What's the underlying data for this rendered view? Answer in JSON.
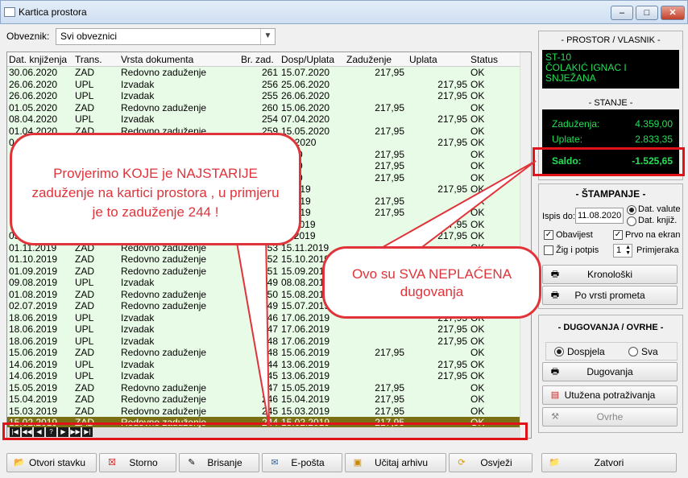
{
  "window": {
    "title": "Kartica prostora",
    "min": "–",
    "max": "□",
    "close": "✕"
  },
  "filter": {
    "label": "Obveznik:",
    "value": "Svi obveznici"
  },
  "table": {
    "columns": [
      "Dat. knjiženja",
      "Trans.",
      "Vrsta dokumenta",
      "Br. zad.",
      "Dosp/Uplata",
      "Zaduženje",
      "Uplata",
      "Status"
    ],
    "rows": [
      [
        "30.06.2020",
        "ZAD",
        "Redovno zaduženje",
        "261",
        "15.07.2020",
        "217,95",
        "",
        "OK"
      ],
      [
        "26.06.2020",
        "UPL",
        "Izvadak",
        "256",
        "25.06.2020",
        "",
        "217,95",
        "OK"
      ],
      [
        "26.06.2020",
        "UPL",
        "Izvadak",
        "255",
        "26.06.2020",
        "",
        "217,95",
        "OK"
      ],
      [
        "01.05.2020",
        "ZAD",
        "Redovno zaduženje",
        "260",
        "15.06.2020",
        "217,95",
        "",
        "OK"
      ],
      [
        "08.04.2020",
        "UPL",
        "Izvadak",
        "254",
        "07.04.2020",
        "",
        "217,95",
        "OK"
      ],
      [
        "01.04.2020",
        "ZAD",
        "Redovno zaduženje",
        "259",
        "15.05.2020",
        "217,95",
        "",
        "OK"
      ],
      [
        "04",
        "",
        "",
        "",
        "03.2020",
        "",
        "217,95",
        "OK"
      ],
      [
        "",
        "",
        "",
        "",
        "2020",
        "217,95",
        "",
        "OK"
      ],
      [
        "",
        "",
        "",
        "",
        "2020",
        "217,95",
        "",
        "OK"
      ],
      [
        "",
        "",
        "",
        "",
        "2020",
        "217,95",
        "",
        "OK"
      ],
      [
        "",
        "",
        "",
        "",
        "2.2019",
        "",
        "217,95",
        "OK"
      ],
      [
        "",
        "",
        "",
        "",
        "2.2019",
        "217,95",
        "",
        "OK"
      ],
      [
        "",
        "",
        "",
        "",
        "1.2019",
        "217,95",
        "",
        "OK"
      ],
      [
        "",
        "",
        "",
        "",
        "11.2019",
        "",
        "217,95",
        "OK"
      ],
      [
        "05",
        "",
        "",
        "",
        "11.2019",
        "",
        "217,95",
        "OK"
      ],
      [
        "01.11.2019",
        "ZAD",
        "Redovno zaduženje",
        "253",
        "15.11.2019",
        "",
        "",
        "OK"
      ],
      [
        "01.10.2019",
        "ZAD",
        "Redovno zaduženje",
        "252",
        "15.10.2019",
        "",
        "",
        "OK"
      ],
      [
        "01.09.2019",
        "ZAD",
        "Redovno zaduženje",
        "251",
        "15.09.2019",
        "",
        "",
        "OK"
      ],
      [
        "09.08.2019",
        "UPL",
        "Izvadak",
        "249",
        "08.08.2019",
        "",
        "",
        "OK"
      ],
      [
        "01.08.2019",
        "ZAD",
        "Redovno zaduženje",
        "250",
        "15.08.2019",
        "",
        "",
        "OK"
      ],
      [
        "02.07.2019",
        "ZAD",
        "Redovno zaduženje",
        "249",
        "15.07.2019",
        "",
        "",
        "OK"
      ],
      [
        "18.06.2019",
        "UPL",
        "Izvadak",
        "246",
        "17.06.2019",
        "",
        "217,95",
        "OK"
      ],
      [
        "18.06.2019",
        "UPL",
        "Izvadak",
        "247",
        "17.06.2019",
        "",
        "217,95",
        "OK"
      ],
      [
        "18.06.2019",
        "UPL",
        "Izvadak",
        "248",
        "17.06.2019",
        "",
        "217,95",
        "OK"
      ],
      [
        "15.06.2019",
        "ZAD",
        "Redovno zaduženje",
        "248",
        "15.06.2019",
        "217,95",
        "",
        "OK"
      ],
      [
        "14.06.2019",
        "UPL",
        "Izvadak",
        "244",
        "13.06.2019",
        "",
        "217,95",
        "OK"
      ],
      [
        "14.06.2019",
        "UPL",
        "Izvadak",
        "245",
        "13.06.2019",
        "",
        "217,95",
        "OK"
      ],
      [
        "15.05.2019",
        "ZAD",
        "Redovno zaduženje",
        "247",
        "15.05.2019",
        "217,95",
        "",
        "OK"
      ],
      [
        "15.04.2019",
        "ZAD",
        "Redovno zaduženje",
        "246",
        "15.04.2019",
        "217,95",
        "",
        "OK"
      ],
      [
        "15.03.2019",
        "ZAD",
        "Redovno zaduženje",
        "245",
        "15.03.2019",
        "217,95",
        "",
        "OK"
      ],
      [
        "15.02.2019",
        "ZAD",
        "Redovno zaduženje",
        "244",
        "15.02.2019",
        "217,95",
        "",
        "OK"
      ]
    ],
    "nav": [
      "|◀",
      "◀◀",
      "◀",
      "?",
      "▶",
      "▶▶",
      "▶|"
    ]
  },
  "callouts": {
    "left": "Provjerimo KOJE je NAJSTARIJE zaduženje na kartici prostora , u primjeru je to zaduženje 244 !",
    "right": "Ovo su SVA NEPLAĆENA dugovanja"
  },
  "prostor": {
    "title": "- PROSTOR / VLASNIK -",
    "line1": "ST-10",
    "line2": "ČOLAKIĆ IGNAC I",
    "line3": "SNJEŽANA"
  },
  "stanje": {
    "title": "- STANJE -",
    "zad_label": "Zaduženja:",
    "zad_value": "4.359,00",
    "upl_label": "Uplate:",
    "upl_value": "2.833,35",
    "saldo_label": "Saldo:",
    "saldo_value": "-1.525,65"
  },
  "stampanje": {
    "title": "- ŠTAMPANJE -",
    "ispis_label": "Ispis do:",
    "ispis_value": "11.08.2020",
    "opt1": "Dat. valute",
    "opt2": "Dat. knjiž.",
    "obavijest": "Obavijest",
    "prvo": "Prvo na ekran",
    "zig": "Žig i potpis",
    "kopije": "1",
    "primjeraka": "Primjeraka",
    "btn_kron": "Kronološki",
    "btn_vrsti": "Po vrsti prometa"
  },
  "dugovanja": {
    "title": "- DUGOVANJA / OVRHE -",
    "opt_dospjela": "Dospjela",
    "opt_sva": "Sva",
    "btn_dug": "Dugovanja",
    "btn_utuz": "Utužena potraživanja",
    "btn_ovrhe": "Ovrhe"
  },
  "footer": {
    "otvori": "Otvori stavku",
    "storno": "Storno",
    "brisanje": "Brisanje",
    "eposta": "E-pošta",
    "ucitaj": "Učitaj arhivu",
    "osvjezi": "Osvježi",
    "zatvori": "Zatvori"
  }
}
